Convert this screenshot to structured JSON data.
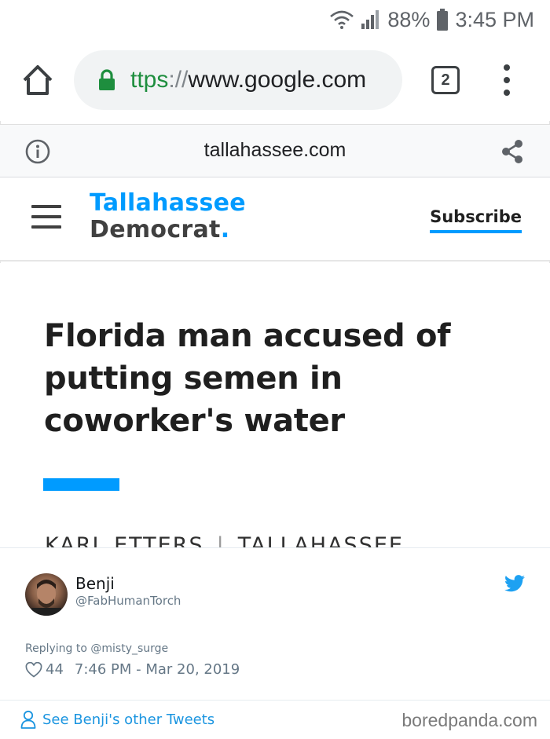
{
  "status_bar": {
    "battery": "88%",
    "time": "3:45 PM",
    "icons": [
      "wifi-icon",
      "signal-icon",
      "battery-icon"
    ]
  },
  "browser": {
    "url_scheme": "ttps",
    "url_separator": "://",
    "url_host": "www.google.com",
    "tab_count": "2",
    "icons": [
      "home-icon",
      "lock-icon",
      "tabs-icon",
      "overflow-menu-icon"
    ]
  },
  "site_info": {
    "domain": "tallahassee.com",
    "icons": [
      "info-icon",
      "share-icon"
    ]
  },
  "site_header": {
    "logo_line1": "Tallahassee",
    "logo_line2": "Democrat",
    "logo_dot": ".",
    "subscribe_label": "Subscribe",
    "accent_color": "#009bff"
  },
  "article": {
    "headline": "Florida man accused of putting semen in coworker's water",
    "byline_author": "KARL ETTERS",
    "byline_separator": "|",
    "byline_location": "TALLAHASSEE"
  },
  "tweet": {
    "name": "Benji",
    "handle": "@FabHumanTorch",
    "replying_to": "Replying to @misty_surge",
    "likes": "44",
    "timestamp": "7:46 PM - Mar 20, 2019",
    "see_more": "See Benji's other Tweets",
    "link_color": "#1b95e0",
    "icons": [
      "twitter-bird-icon",
      "heart-icon",
      "person-icon"
    ]
  },
  "watermark": "boredpanda.com"
}
